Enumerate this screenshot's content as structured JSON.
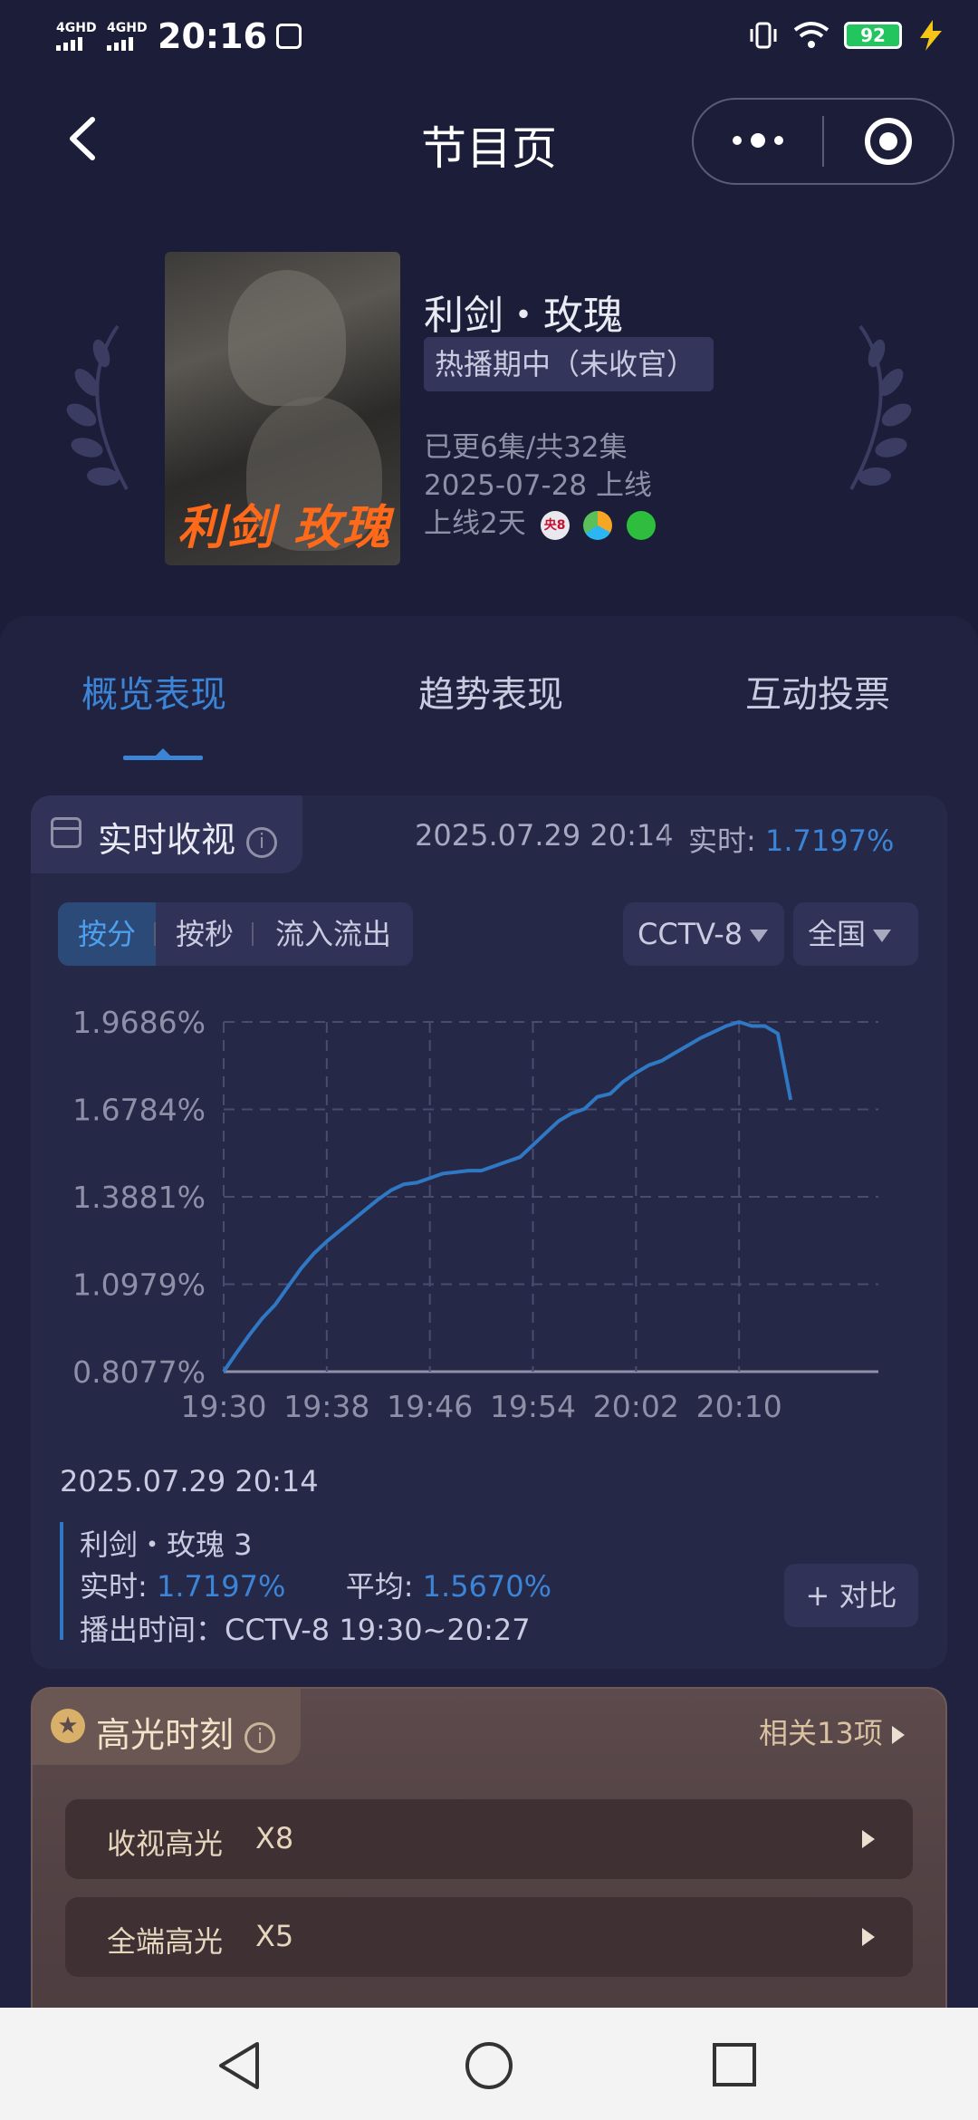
{
  "status_bar": {
    "net1": "4GHD",
    "net2": "4GHD",
    "time": "20:16",
    "battery": "92"
  },
  "header": {
    "title": "节目页"
  },
  "program": {
    "name": "利剑・玫瑰",
    "status_tag": "热播期中（未收官）",
    "episodes": "已更6集/共32集",
    "release": "2025-07-28 上线",
    "days_online": "上线2天",
    "poster_text": "利剑 玫瑰",
    "platform_cctv8": "央8"
  },
  "tabs": [
    {
      "label": "概览表现",
      "active": true
    },
    {
      "label": "趋势表现",
      "active": false
    },
    {
      "label": "互动投票",
      "active": false
    }
  ],
  "realtime": {
    "title": "实时收视",
    "timestamp": "2025.07.29 20:14",
    "label": "实时:",
    "value": "1.7197%",
    "segments": [
      "按分",
      "按秒",
      "流入流出"
    ],
    "channel": "CCTV-8",
    "region": "全国"
  },
  "chart_data": {
    "type": "line",
    "x_ticks": [
      "19:30",
      "19:38",
      "19:46",
      "19:54",
      "20:02",
      "20:10"
    ],
    "y_ticks": [
      "1.9686%",
      "1.6784%",
      "1.3881%",
      "1.0979%",
      "0.8077%"
    ],
    "ylim": [
      0.8077,
      1.9686
    ],
    "xlim_minutes": [
      0,
      48
    ],
    "grid": true,
    "color": "#2f78c4",
    "points": [
      [
        0,
        0.8077
      ],
      [
        1,
        0.87
      ],
      [
        2,
        0.93
      ],
      [
        3,
        0.985
      ],
      [
        4,
        1.03
      ],
      [
        5,
        1.09
      ],
      [
        6,
        1.15
      ],
      [
        7,
        1.2
      ],
      [
        8,
        1.24
      ],
      [
        9,
        1.275
      ],
      [
        10,
        1.31
      ],
      [
        11,
        1.345
      ],
      [
        12,
        1.38
      ],
      [
        13,
        1.41
      ],
      [
        14,
        1.43
      ],
      [
        15,
        1.435
      ],
      [
        16,
        1.45
      ],
      [
        17,
        1.465
      ],
      [
        18,
        1.47
      ],
      [
        19,
        1.475
      ],
      [
        20,
        1.475
      ],
      [
        21,
        1.49
      ],
      [
        22,
        1.505
      ],
      [
        23,
        1.52
      ],
      [
        24,
        1.56
      ],
      [
        25,
        1.6
      ],
      [
        26,
        1.64
      ],
      [
        27,
        1.665
      ],
      [
        28,
        1.68
      ],
      [
        29,
        1.72
      ],
      [
        30,
        1.73
      ],
      [
        31,
        1.77
      ],
      [
        32,
        1.8
      ],
      [
        33,
        1.825
      ],
      [
        34,
        1.84
      ],
      [
        35,
        1.865
      ],
      [
        36,
        1.89
      ],
      [
        37,
        1.915
      ],
      [
        38,
        1.935
      ],
      [
        39,
        1.955
      ],
      [
        40,
        1.9686
      ],
      [
        41,
        1.955
      ],
      [
        42,
        1.955
      ],
      [
        43,
        1.93
      ],
      [
        44,
        1.71
      ]
    ]
  },
  "detail": {
    "timestamp": "2025.07.29 20:14",
    "episode": "利剑・玫瑰 3",
    "realtime_label": "实时:",
    "realtime_value": "1.7197%",
    "avg_label": "平均:",
    "avg_value": "1.5670%",
    "airtime": "播出时间：CCTV-8 19:30~20:27",
    "compare_button": "+ 对比"
  },
  "highlights": {
    "title": "高光时刻",
    "more": "相关13项",
    "rows": [
      {
        "label": "收视高光",
        "count": "X8"
      },
      {
        "label": "全端高光",
        "count": "X5"
      }
    ]
  }
}
